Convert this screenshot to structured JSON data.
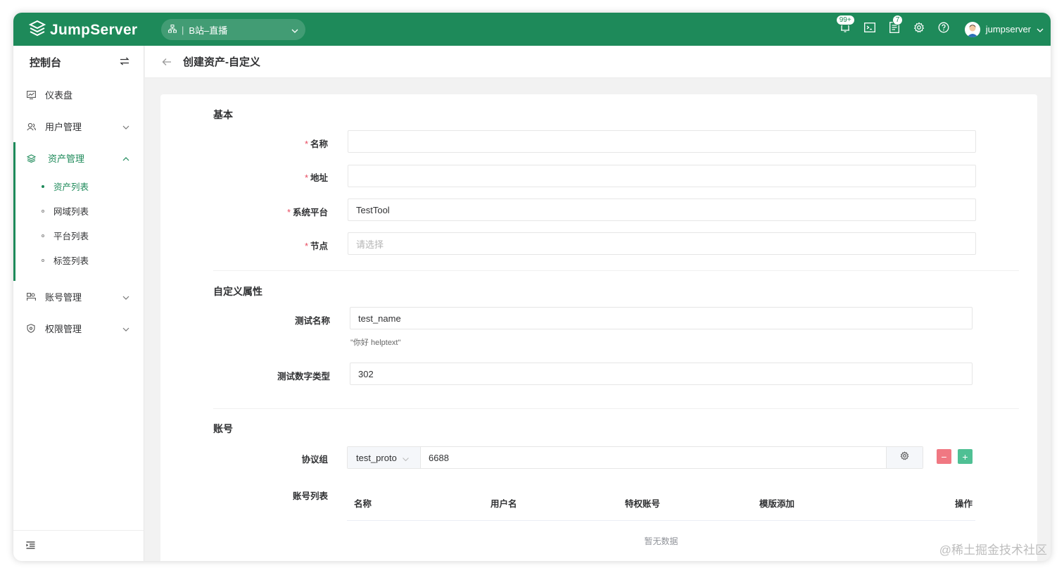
{
  "brand": {
    "name": "JumpServer"
  },
  "header": {
    "org_selector": "B站–直播",
    "notifications_badge": "99+",
    "tickets_badge": "7",
    "username": "jumpserver"
  },
  "sidebar": {
    "title": "控制台",
    "items": [
      {
        "label": "仪表盘"
      },
      {
        "label": "用户管理"
      },
      {
        "label": "资产管理"
      },
      {
        "label": "账号管理"
      },
      {
        "label": "权限管理"
      }
    ],
    "asset_sub": [
      {
        "label": "资产列表"
      },
      {
        "label": "网域列表"
      },
      {
        "label": "平台列表"
      },
      {
        "label": "标签列表"
      }
    ]
  },
  "page": {
    "title": "创建资产-自定义"
  },
  "form": {
    "basic": {
      "section": "基本",
      "name_label": "名称",
      "name_value": "",
      "address_label": "地址",
      "address_value": "",
      "platform_label": "系统平台",
      "platform_value": "TestTool",
      "node_label": "节点",
      "node_placeholder": "请选择"
    },
    "custom": {
      "section": "自定义属性",
      "test_name_label": "测试名称",
      "test_name_value": "test_name",
      "test_name_help": "\"你好 helptext\"",
      "test_number_label": "测试数字类型",
      "test_number_value": "302"
    },
    "account": {
      "section": "账号",
      "protocol_label": "协议组",
      "protocol_name": "test_proto",
      "protocol_port": "6688",
      "remove_button": "−",
      "add_button": "+",
      "list_label": "账号列表",
      "columns": [
        "名称",
        "用户名",
        "特权账号",
        "模版添加",
        "操作"
      ],
      "empty_text": "暂无数据"
    }
  },
  "watermark": "@稀土掘金技术社区",
  "colors": {
    "brand": "#1e8a5a",
    "danger": "#f07882",
    "success": "#4fc094"
  }
}
